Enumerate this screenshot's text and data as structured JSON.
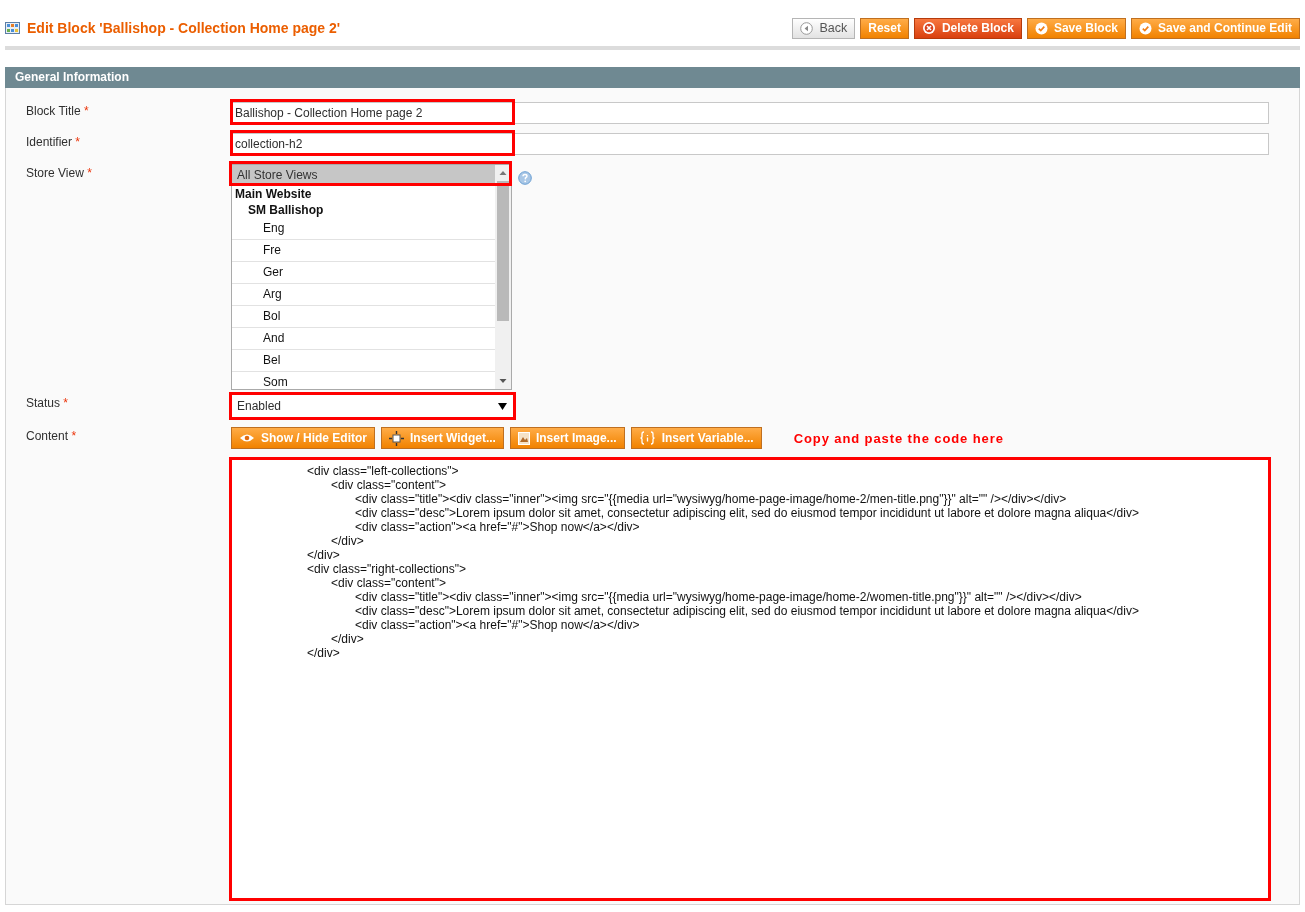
{
  "page_header": {
    "title": "Edit Block 'Ballishop - Collection Home page 2'"
  },
  "buttons": [
    {
      "label": "Back",
      "kind": "back"
    },
    {
      "label": "Reset",
      "kind": "plain"
    },
    {
      "label": "Delete Block",
      "kind": "delete"
    },
    {
      "label": "Save Block",
      "kind": "save"
    },
    {
      "label": "Save and Continue Edit",
      "kind": "save"
    }
  ],
  "section": {
    "title": "General Information"
  },
  "fields": [
    {
      "kind": "text",
      "label": "Block Title",
      "mark": "*",
      "value": "Ballishop - Collection Home page 2",
      "highlighted": true
    },
    {
      "kind": "text",
      "label": "Identifier",
      "mark": "*",
      "value": "collection-h2",
      "highlighted": true
    },
    {
      "kind": "multiselect",
      "label": "Store View",
      "mark": "*",
      "highlighted": true,
      "options": [
        {
          "label": "All Store Views",
          "kind": "option",
          "selected": true
        },
        {
          "label": "Main Website",
          "kind": "group",
          "children": [
            {
              "label": "SM Ballishop",
              "kind": "group",
              "children": [
                {
                  "label": "Eng",
                  "kind": "option",
                  "selected": false
                },
                {
                  "label": "Fre",
                  "kind": "option",
                  "selected": false
                },
                {
                  "label": "Ger",
                  "kind": "option",
                  "selected": false
                },
                {
                  "label": "Arg",
                  "kind": "option",
                  "selected": false
                },
                {
                  "label": "Bol",
                  "kind": "option",
                  "selected": false
                },
                {
                  "label": "And",
                  "kind": "option",
                  "selected": false
                },
                {
                  "label": "Bel",
                  "kind": "option",
                  "selected": false
                },
                {
                  "label": "Som",
                  "kind": "option",
                  "selected": false
                }
              ]
            }
          ]
        }
      ]
    },
    {
      "kind": "select",
      "label": "Status",
      "mark": "*",
      "value": "Enabled",
      "highlighted": true
    },
    {
      "kind": "editor",
      "label": "Content",
      "mark": "*",
      "highlighted": true,
      "note": "Copy and paste the code here",
      "toolbar": [
        {
          "label": "Show / Hide Editor",
          "kind": "eye"
        },
        {
          "label": "Insert Widget...",
          "kind": "widget"
        },
        {
          "label": "Insert Image...",
          "kind": "image"
        },
        {
          "label": "Insert Variable...",
          "kind": "variable"
        }
      ],
      "value": "\t\t\t<div class=\"left-collections\">\n\t\t\t\t<div class=\"content\">\n\t\t\t\t\t<div class=\"title\"><div class=\"inner\"><img src=\"{{media url=\"wysiwyg/home-page-image/home-2/men-title.png\"}}\" alt=\"\" /></div></div>\n\t\t\t\t\t<div class=\"desc\">Lorem ipsum dolor sit amet, consectetur adipiscing elit, sed do eiusmod tempor incididunt ut labore et dolore magna aliqua</div>\n\t\t\t\t\t<div class=\"action\"><a href=\"#\">Shop now</a></div>\n\t\t\t\t</div>\n\t\t\t</div>\n\t\t\t<div class=\"right-collections\">\n\t\t\t\t<div class=\"content\">\n\t\t\t\t\t<div class=\"title\"><div class=\"inner\"><img src=\"{{media url=\"wysiwyg/home-page-image/home-2/women-title.png\"}}\" alt=\"\" /></div></div>\n\t\t\t\t\t<div class=\"desc\">Lorem ipsum dolor sit amet, consectetur adipiscing elit, sed do eiusmod tempor incididunt ut labore et dolore magna aliqua</div>\n\t\t\t\t\t<div class=\"action\"><a href=\"#\">Shop now</a></div>\n\t\t\t\t</div>\n\t\t\t</div>"
    }
  ]
}
